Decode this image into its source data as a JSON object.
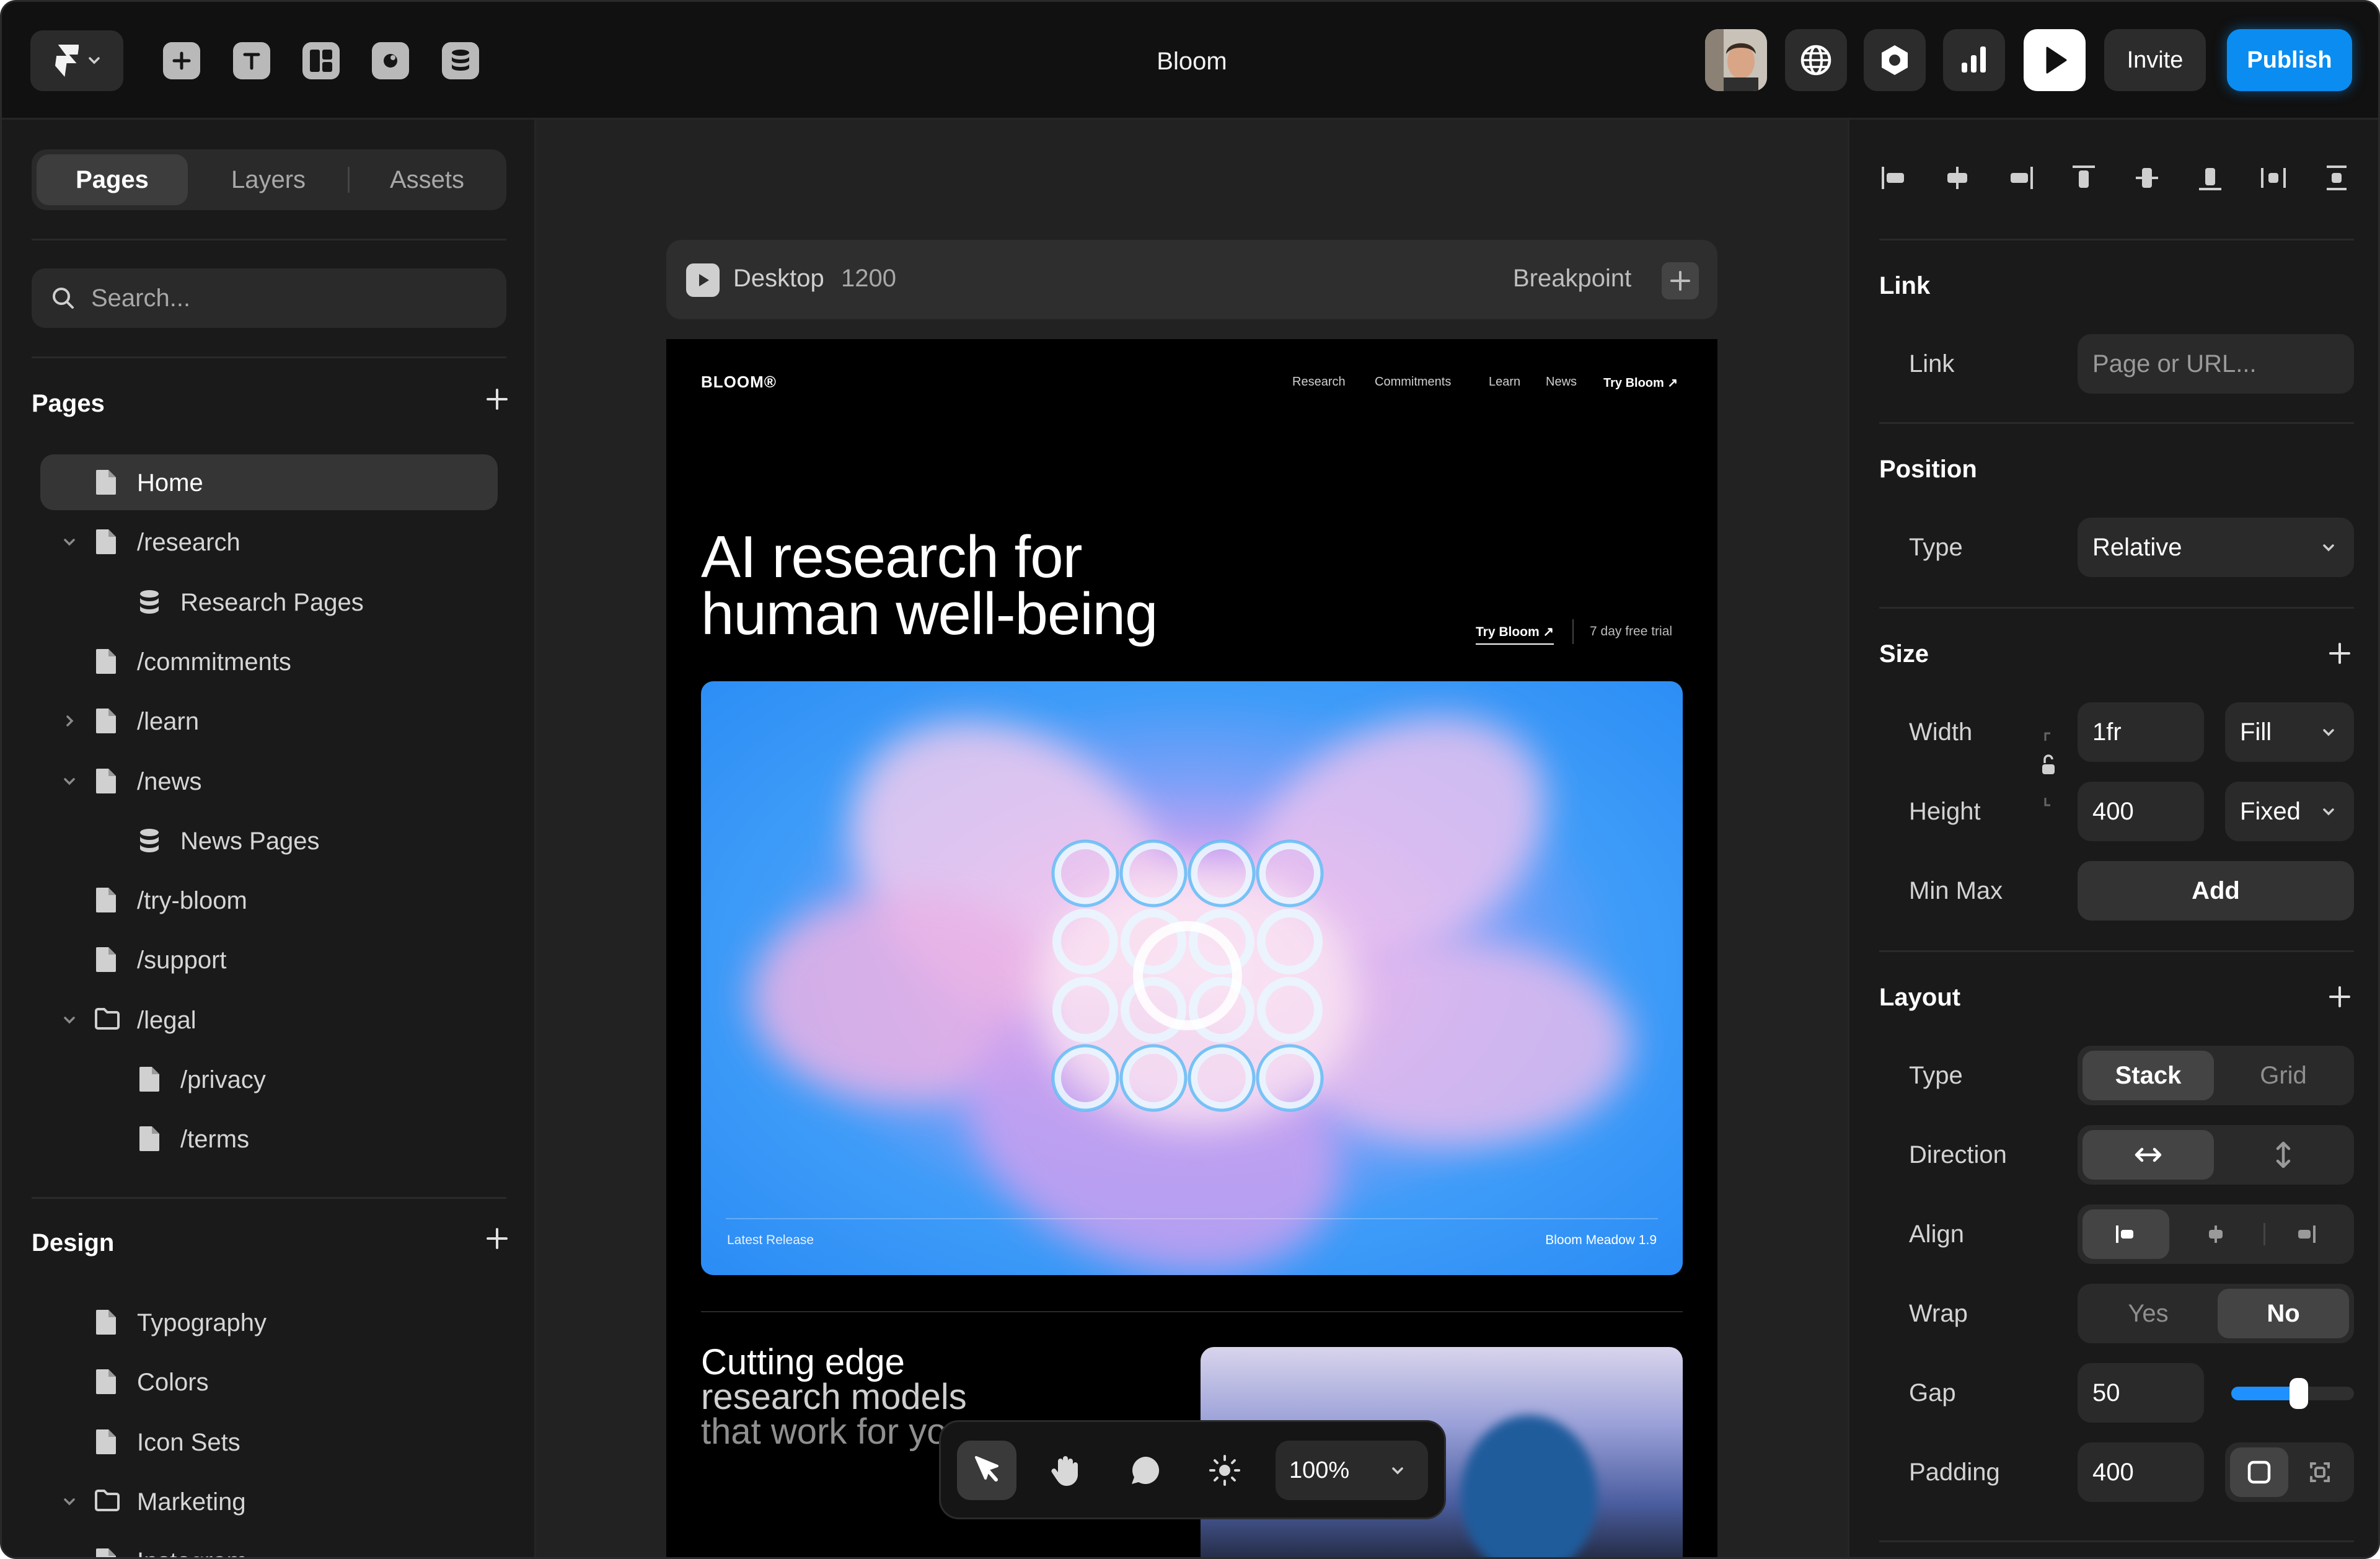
{
  "topbar": {
    "title": "Bloom",
    "tools": [
      "insert-icon",
      "text-icon",
      "layout-icon",
      "components-icon",
      "cms-icon"
    ],
    "invite_label": "Invite",
    "publish_label": "Publish",
    "accent": "#0a8cf0"
  },
  "left": {
    "tabs": [
      "Pages",
      "Layers",
      "Assets"
    ],
    "active_tab": "Pages",
    "search_placeholder": "Search...",
    "pages_title": "Pages",
    "pages": [
      {
        "label": "Home",
        "type": "page",
        "level": 0,
        "active": true
      },
      {
        "label": "/research",
        "type": "page",
        "level": 0,
        "expanded": true
      },
      {
        "label": "Research Pages",
        "type": "cms",
        "level": 1
      },
      {
        "label": "/commitments",
        "type": "page",
        "level": 0
      },
      {
        "label": "/learn",
        "type": "page",
        "level": 0,
        "collapsed": true
      },
      {
        "label": "/news",
        "type": "page",
        "level": 0,
        "expanded": true
      },
      {
        "label": "News Pages",
        "type": "cms",
        "level": 1
      },
      {
        "label": "/try-bloom",
        "type": "page",
        "level": 0
      },
      {
        "label": "/support",
        "type": "page",
        "level": 0
      },
      {
        "label": "/legal",
        "type": "folder",
        "level": 0,
        "expanded": true
      },
      {
        "label": "/privacy",
        "type": "page",
        "level": 1
      },
      {
        "label": "/terms",
        "type": "page",
        "level": 1
      }
    ],
    "design_title": "Design",
    "design": [
      {
        "label": "Typography",
        "type": "page"
      },
      {
        "label": "Colors",
        "type": "page"
      },
      {
        "label": "Icon Sets",
        "type": "page"
      },
      {
        "label": "Marketing",
        "type": "folder",
        "expanded": true
      },
      {
        "label": "Instagram",
        "type": "page"
      }
    ]
  },
  "canvas": {
    "breakpoint_name": "Desktop",
    "breakpoint_width": "1200",
    "breakpoint_label": "Breakpoint",
    "site": {
      "logo": "BLOOM®",
      "nav": [
        "Research",
        "Commitments",
        "Learn",
        "News",
        "Try Bloom ↗"
      ],
      "headline_1": "AI research for",
      "headline_2": "human well-being",
      "cta": "Try Bloom ↗",
      "trial": "7 day free trial",
      "hero_caption_left": "Latest Release",
      "hero_caption_right": "Bloom Meadow 1.9",
      "section_1": "Cutting edge",
      "section_2": "research models",
      "section_3": "that work for yo"
    },
    "zoom": "100%"
  },
  "right": {
    "link_title": "Link",
    "link_label": "Link",
    "link_placeholder": "Page or URL...",
    "position_title": "Position",
    "position_type_label": "Type",
    "position_type": "Relative",
    "size_title": "Size",
    "width_label": "Width",
    "width_value": "1fr",
    "width_mode": "Fill",
    "height_label": "Height",
    "height_value": "400",
    "height_mode": "Fixed",
    "minmax_label": "Min Max",
    "minmax_button": "Add",
    "layout_title": "Layout",
    "layout_type_label": "Type",
    "layout_types": [
      "Stack",
      "Grid"
    ],
    "layout_type_active": "Stack",
    "direction_label": "Direction",
    "align_label": "Align",
    "wrap_label": "Wrap",
    "wrap_options": [
      "Yes",
      "No"
    ],
    "wrap_active": "No",
    "gap_label": "Gap",
    "gap_value": "50",
    "gap_slider_fraction": 0.5,
    "padding_label": "Padding",
    "padding_value": "400"
  }
}
